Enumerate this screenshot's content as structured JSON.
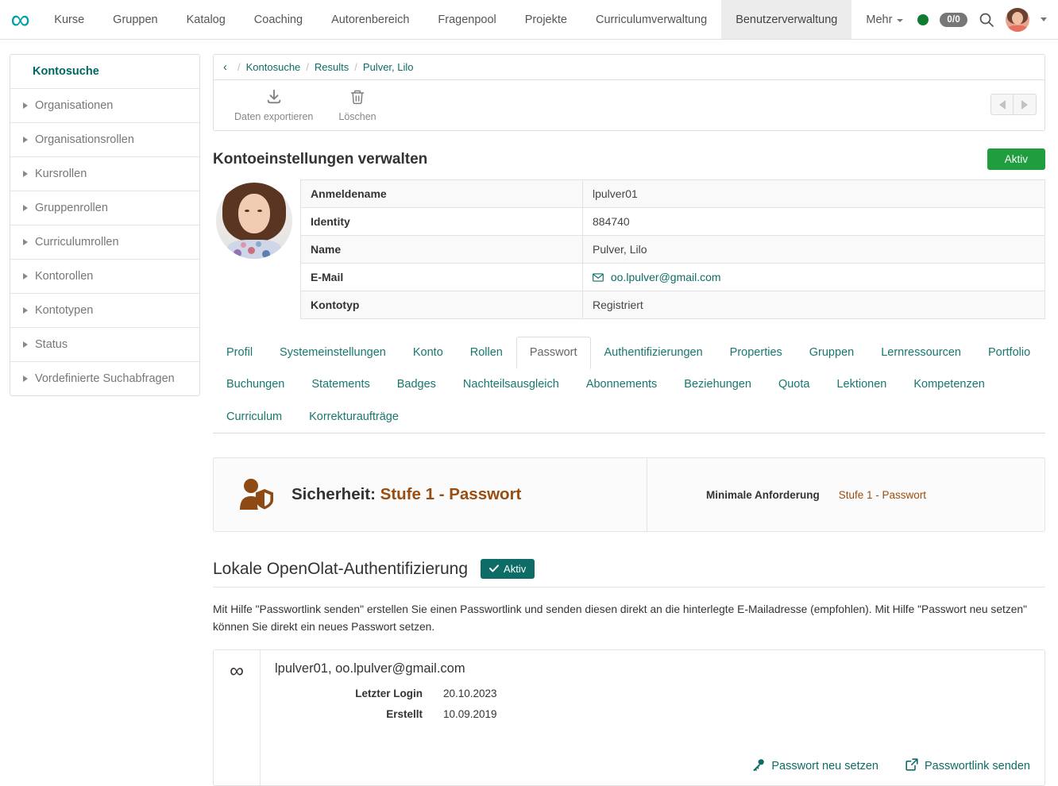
{
  "topnav": {
    "logo_icon": "infinity-logo",
    "items": [
      {
        "label": "Kurse",
        "active": false
      },
      {
        "label": "Gruppen",
        "active": false
      },
      {
        "label": "Katalog",
        "active": false
      },
      {
        "label": "Coaching",
        "active": false
      },
      {
        "label": "Autorenbereich",
        "active": false
      },
      {
        "label": "Fragenpool",
        "active": false
      },
      {
        "label": "Projekte",
        "active": false
      },
      {
        "label": "Curriculumverwaltung",
        "active": false
      },
      {
        "label": "Benutzerverwaltung",
        "active": true
      },
      {
        "label": "Mehr",
        "active": false
      }
    ],
    "status_dot_color": "#107c2f",
    "task_count": "0/0",
    "search_icon": "search-icon",
    "avatar_icon": "user-avatar"
  },
  "sidebar": {
    "header": "Kontosuche",
    "items": [
      {
        "label": "Organisationen"
      },
      {
        "label": "Organisationsrollen"
      },
      {
        "label": "Kursrollen"
      },
      {
        "label": "Gruppenrollen"
      },
      {
        "label": "Curriculumrollen"
      },
      {
        "label": "Kontorollen"
      },
      {
        "label": "Kontotypen"
      },
      {
        "label": "Status"
      },
      {
        "label": "Vordefinierte Suchabfragen"
      }
    ]
  },
  "breadcrumb": {
    "back_icon": "chevron-left-icon",
    "items": [
      "Kontosuche",
      "Results",
      "Pulver, Lilo"
    ],
    "separator": "/"
  },
  "toolbar": {
    "export_label": "Daten exportieren",
    "export_icon": "download-icon",
    "delete_label": "Löschen",
    "delete_icon": "trash-icon",
    "prev_icon": "arrow-left-icon",
    "next_icon": "arrow-right-icon"
  },
  "account": {
    "title": "Kontoeinstellungen verwalten",
    "status_badge": "Aktiv",
    "status_badge_color": "#1f9d3f",
    "rows": [
      {
        "key": "Anmeldename",
        "value": "lpulver01",
        "type": "text"
      },
      {
        "key": "Identity",
        "value": "884740",
        "type": "text"
      },
      {
        "key": "Name",
        "value": "Pulver, Lilo",
        "type": "text"
      },
      {
        "key": "E-Mail",
        "value": "oo.lpulver@gmail.com",
        "type": "email"
      },
      {
        "key": "Kontotyp",
        "value": "Registriert",
        "type": "text"
      }
    ]
  },
  "tabs": {
    "row1": [
      {
        "label": "Profil",
        "active": false
      },
      {
        "label": "Systemeinstellungen",
        "active": false
      },
      {
        "label": "Konto",
        "active": false
      },
      {
        "label": "Rollen",
        "active": false
      },
      {
        "label": "Passwort",
        "active": true
      },
      {
        "label": "Authentifizierungen",
        "active": false
      },
      {
        "label": "Properties",
        "active": false
      },
      {
        "label": "Gruppen",
        "active": false
      },
      {
        "label": "Lernressourcen",
        "active": false
      },
      {
        "label": "Portfolio",
        "active": false
      }
    ],
    "row2": [
      {
        "label": "Buchungen",
        "active": false
      },
      {
        "label": "Statements",
        "active": false
      },
      {
        "label": "Badges",
        "active": false
      },
      {
        "label": "Nachteilsausgleich",
        "active": false
      },
      {
        "label": "Abonnements",
        "active": false
      },
      {
        "label": "Beziehungen",
        "active": false
      },
      {
        "label": "Quota",
        "active": false
      },
      {
        "label": "Lektionen",
        "active": false
      },
      {
        "label": "Kompetenzen",
        "active": false
      }
    ],
    "row3": [
      {
        "label": "Curriculum",
        "active": false
      },
      {
        "label": "Korrekturaufträge",
        "active": false
      }
    ]
  },
  "security": {
    "icon": "user-shield-icon",
    "icon_color": "#8e4a14",
    "label": "Sicherheit:",
    "level": "Stufe 1 - Passwort",
    "min_req_label": "Minimale Anforderung",
    "min_req_value": "Stufe 1 - Passwort",
    "accent_color": "#9a4d10"
  },
  "auth": {
    "heading": "Lokale OpenOlat-Authentifizierung",
    "badge": "Aktiv",
    "badge_icon": "check-icon",
    "badge_color": "#0d6c66",
    "description": "Mit Hilfe \"Passwortlink senden\" erstellen Sie einen Passwortlink und senden diesen direkt an die hinterlegte E-Mailadresse (empfohlen). Mit Hilfe \"Passwort neu setzen\" können Sie direkt ein neues Passwort setzen.",
    "card": {
      "logo_icon": "infinity-icon",
      "user_line": "lpulver01, oo.lpulver@gmail.com",
      "fields": [
        {
          "key": "Letzter Login",
          "value": "20.10.2023"
        },
        {
          "key": "Erstellt",
          "value": "10.09.2019"
        }
      ],
      "actions": [
        {
          "label": "Passwort neu setzen",
          "icon": "key-icon"
        },
        {
          "label": "Passwortlink senden",
          "icon": "external-link-icon"
        }
      ]
    }
  }
}
